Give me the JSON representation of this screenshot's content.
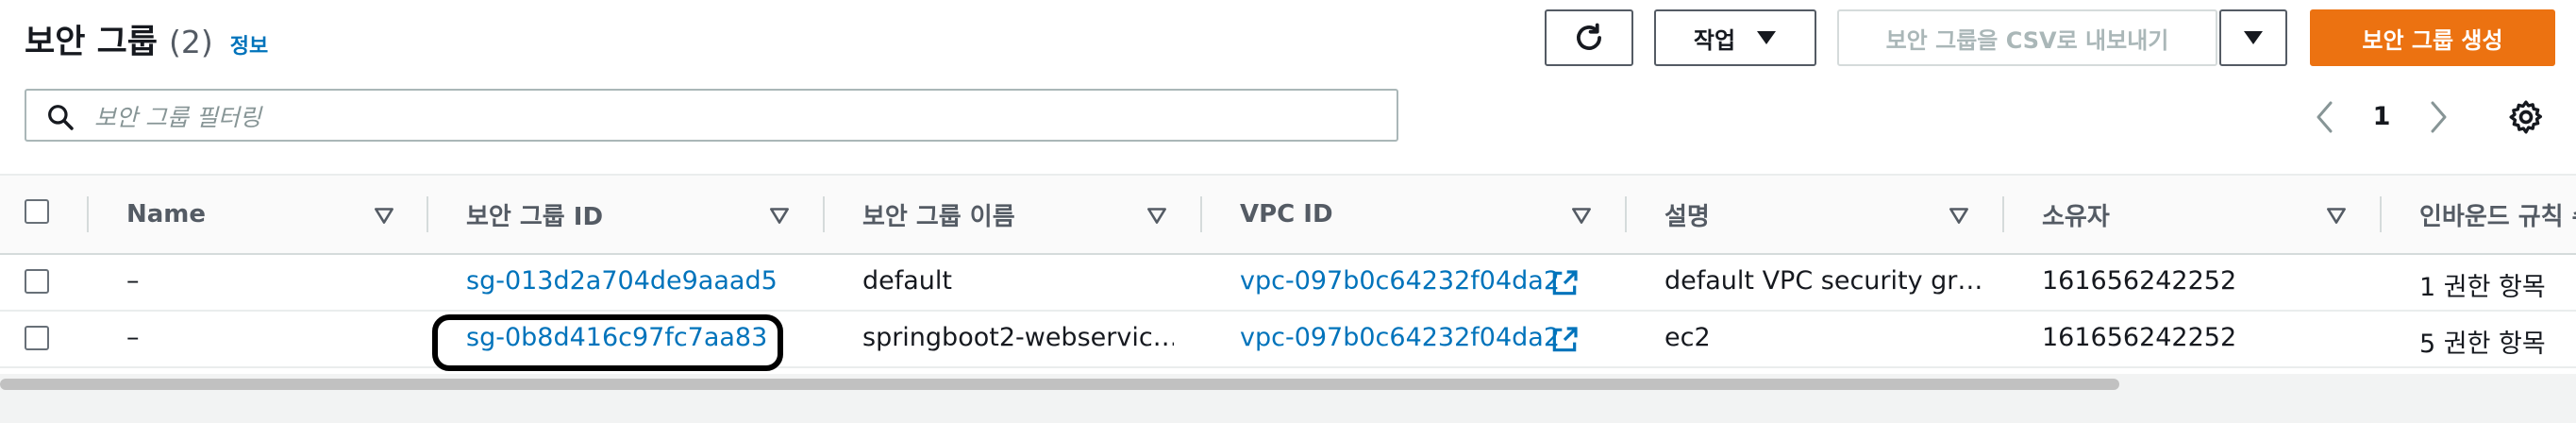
{
  "header": {
    "title": "보안 그룹",
    "count": "(2)",
    "info": "정보"
  },
  "toolbar": {
    "refresh_icon": "refresh-icon",
    "actions_label": "작업",
    "export_label": "보안 그룹을 CSV로 내보내기",
    "create_label": "보안 그룹 생성"
  },
  "search": {
    "placeholder": "보안 그룹 필터링",
    "value": ""
  },
  "pagination": {
    "current_page": "1"
  },
  "table": {
    "columns": [
      "Name",
      "보안 그룹 ID",
      "보안 그룹 이름",
      "VPC ID",
      "설명",
      "소유자",
      "인바운드 규칙 수"
    ],
    "rows": [
      {
        "name": "–",
        "sg_id": "sg-013d2a704de9aaad5",
        "sg_name": "default",
        "vpc_id": "vpc-097b0c64232f04da2",
        "description": "default VPC security gr…",
        "owner": "161656242252",
        "inbound": "1 권한 항목"
      },
      {
        "name": "–",
        "sg_id": "sg-0b8d416c97fc7aa83",
        "sg_name": "springboot2-webservic…",
        "vpc_id": "vpc-097b0c64232f04da2",
        "description": "ec2",
        "owner": "161656242252",
        "inbound": "5 권한 항목"
      }
    ]
  },
  "colors": {
    "primary": "#ec7211",
    "link": "#0073bb",
    "highlight": "#000000"
  }
}
